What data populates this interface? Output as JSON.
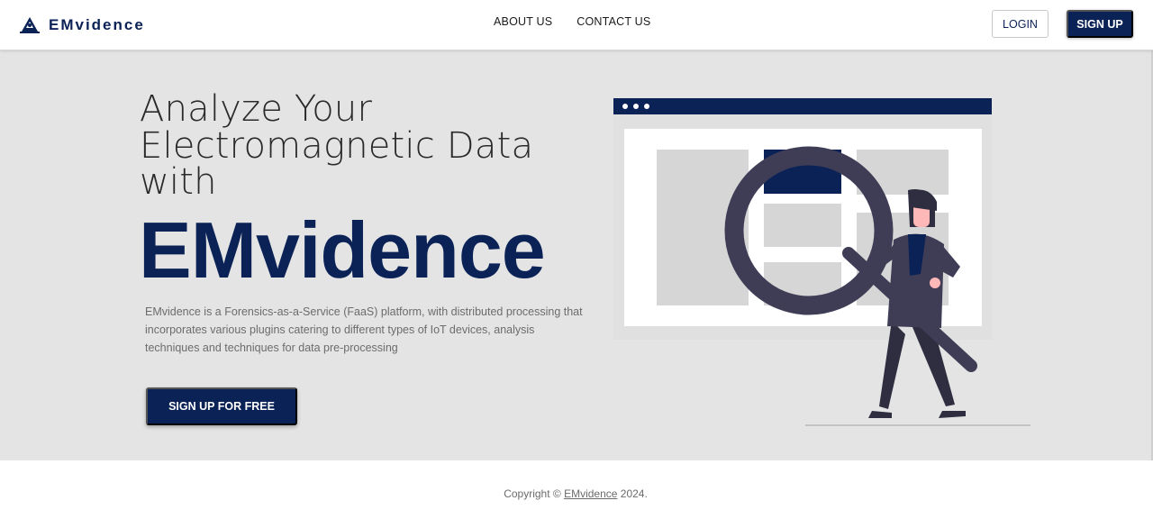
{
  "nav": {
    "brand": "EMvidence",
    "links": [
      "ABOUT US",
      "CONTACT US"
    ],
    "login": "LOGIN",
    "signup": "SIGN UP"
  },
  "hero": {
    "headline_line1": "Analyze Your",
    "headline_line2": "Electromagnetic Data",
    "headline_line3": "with",
    "brand": "EMvidence",
    "description": "EMvidence is a Forensics-as-a-Service (FaaS) platform, with distributed processing that incorporates various plugins catering to different types of IoT devices, analysis techniques and techniques for data pre-processing",
    "cta": "SIGN UP FOR FREE",
    "illustration": "woman-with-magnifier-illustration"
  },
  "footer": {
    "prefix": "Copyright © ",
    "link": "EMvidence",
    "suffix": " 2024."
  },
  "colors": {
    "primary": "#0b2257",
    "hero_bg": "#e4e4e4",
    "text_muted": "#6c6c6c"
  }
}
